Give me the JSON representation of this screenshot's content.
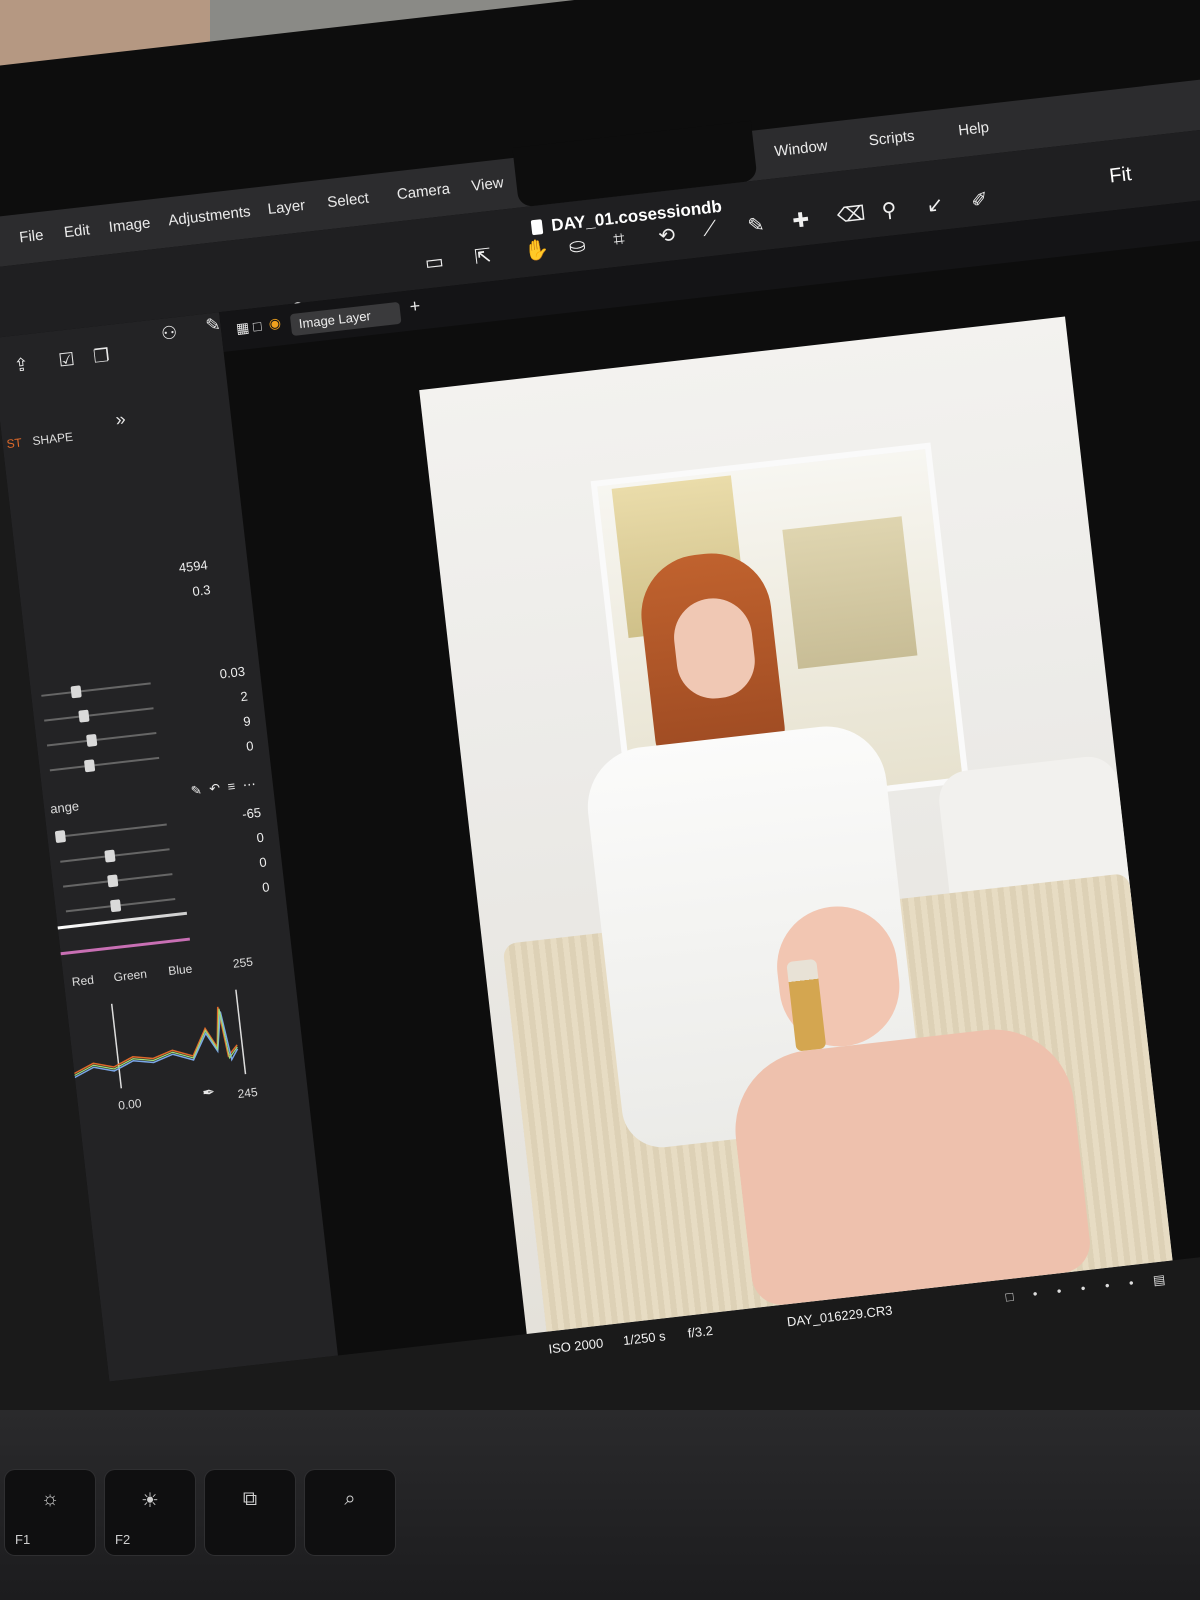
{
  "menubar": {
    "items": [
      "File",
      "Edit",
      "Image",
      "Adjustments",
      "Layer",
      "Select",
      "Camera",
      "View",
      "Window",
      "Scripts",
      "Help"
    ]
  },
  "toolbar": {
    "document_title": "DAY_01.cosessiondb",
    "fit_label": "Fit"
  },
  "layer_bar": {
    "layer_select_value": "Image Layer"
  },
  "sidebar": {
    "tab_partial": "ST",
    "tab_shape": "SHAPE",
    "white_balance": {
      "kelvin": "4594",
      "tint": "0.3"
    },
    "exposure": {
      "values": [
        "0.03",
        "2",
        "9",
        "0"
      ]
    },
    "hdr": {
      "title_partial": "ange",
      "values": [
        "-65",
        "0",
        "0",
        "0"
      ]
    },
    "levels": {
      "channels": [
        "Red",
        "Green",
        "Blue"
      ],
      "max_label": "255",
      "min_value": "0.00",
      "right_value": "245"
    }
  },
  "viewer": {
    "exif": {
      "iso": "ISO 2000",
      "shutter": "1/250 s",
      "aperture": "f/3.2",
      "filename": "DAY_016229.CR3"
    }
  },
  "keyboard": {
    "keys": [
      {
        "fn": "F1",
        "icon": "brightness-down-icon"
      },
      {
        "fn": "F2",
        "icon": "brightness-up-icon"
      },
      {
        "fn": "",
        "icon": "mission-control-icon"
      },
      {
        "fn": "",
        "icon": "search-icon"
      }
    ]
  }
}
